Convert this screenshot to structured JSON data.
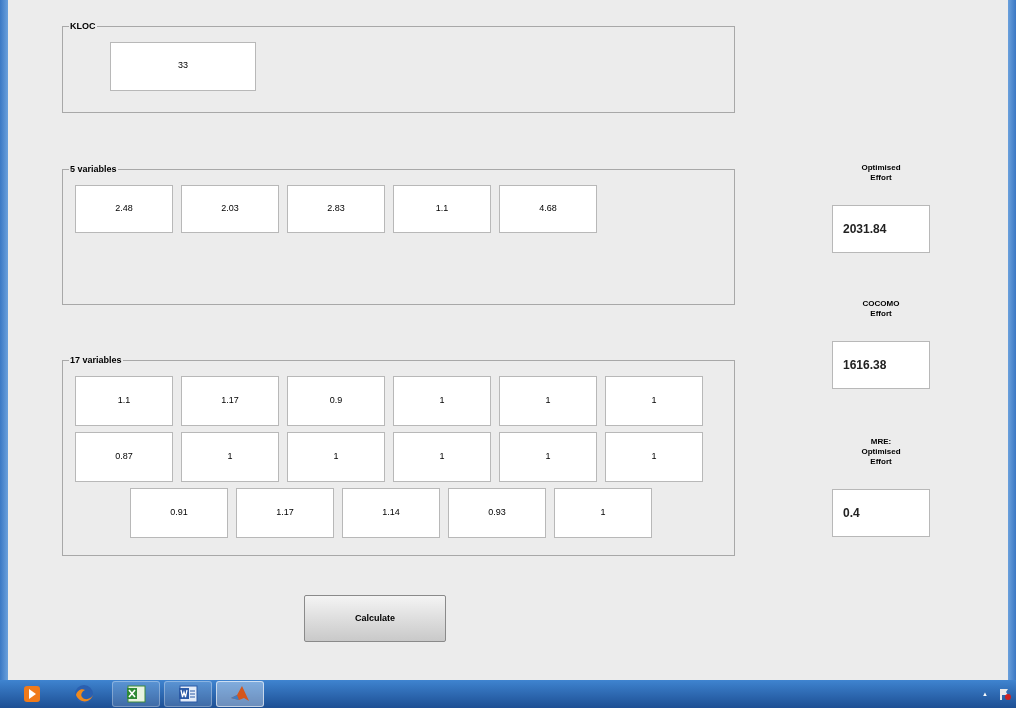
{
  "kloc": {
    "title": "KLOC",
    "value": "33"
  },
  "five_variables": {
    "title": "5 variables",
    "values": [
      "2.48",
      "2.03",
      "2.83",
      "1.1",
      "4.68"
    ]
  },
  "seventeen_variables": {
    "title": "17 variables",
    "rows": [
      [
        "1.1",
        "1.17",
        "0.9",
        "1",
        "1",
        "1"
      ],
      [
        "0.87",
        "1",
        "1",
        "1",
        "1",
        "1"
      ],
      [
        "0.91",
        "1.17",
        "1.14",
        "0.93",
        "1"
      ]
    ]
  },
  "outputs": [
    {
      "label": [
        "Optimised",
        "Effort"
      ],
      "value": "2031.84"
    },
    {
      "label": [
        "COCOMO",
        "Effort"
      ],
      "value": "1616.38"
    },
    {
      "label": [
        "MRE:",
        "Optimised",
        "Effort"
      ],
      "value": "0.4"
    }
  ],
  "calculate_button": "Calculate",
  "taskbar": {
    "apps": [
      {
        "kind": "media",
        "selected": false
      },
      {
        "kind": "browser",
        "selected": false
      },
      {
        "kind": "spreadsheet",
        "selected": false
      },
      {
        "kind": "document",
        "selected": false
      },
      {
        "kind": "matlab",
        "selected": true
      }
    ],
    "tray_arrow": "▲"
  }
}
